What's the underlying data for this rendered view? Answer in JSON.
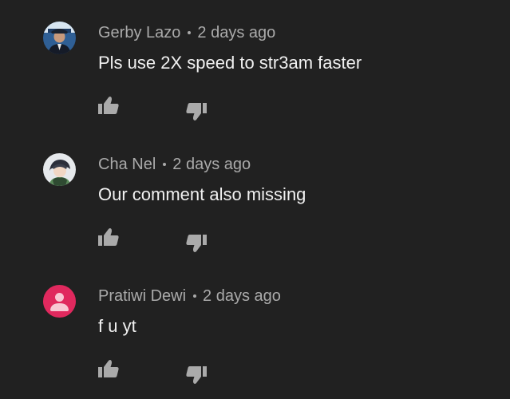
{
  "comments": [
    {
      "author": "Gerby Lazo",
      "age": "2 days ago",
      "text": "Pls use 2X speed to str3am faster",
      "avatar": "photo-avatar-icon"
    },
    {
      "author": "Cha Nel",
      "age": "2 days ago",
      "text": "Our comment also missing",
      "avatar": "anime-avatar-icon"
    },
    {
      "author": "Pratiwi Dewi",
      "age": "2 days ago",
      "text": "f u yt",
      "avatar": "default-user-icon"
    }
  ],
  "icons": {
    "like": "thumbs-up-icon",
    "dislike": "thumbs-down-icon"
  },
  "colors": {
    "background": "#212121",
    "meta_text": "#aaaaaa",
    "body_text": "#f1f1f1",
    "icon": "#aaaaaa",
    "default_avatar": "#e0295e"
  }
}
